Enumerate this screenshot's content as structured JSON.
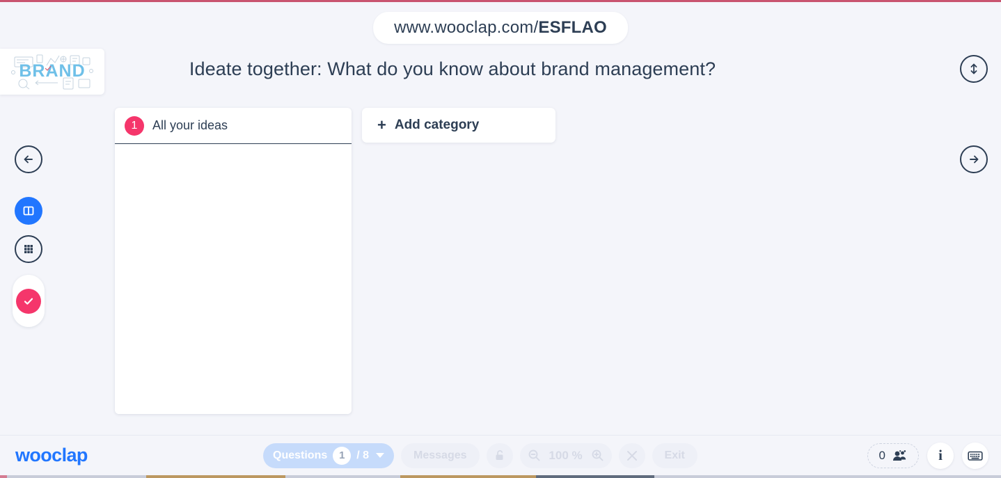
{
  "topbar": {
    "url_prefix": "www.wooclap.com/",
    "url_code": "ESFLAO"
  },
  "header": {
    "logo_alt": "BRAND",
    "logo_word": "BRAND",
    "question_title": "Ideate together: What do you know about brand management?"
  },
  "sidebar": {
    "items": [
      {
        "name": "previous-slide",
        "icon": "arrow-left-icon"
      },
      {
        "name": "columns-view",
        "icon": "columns-icon"
      },
      {
        "name": "grid-view",
        "icon": "grid-icon"
      },
      {
        "name": "validate-toggle",
        "icon": "check-icon"
      }
    ]
  },
  "rightbar": {
    "expand_icon": "arrows-up-down-icon",
    "next_icon": "arrow-right-icon"
  },
  "board": {
    "categories": [
      {
        "badge": "1",
        "label": "All your ideas",
        "ideas": []
      }
    ],
    "add_category": {
      "plus": "+",
      "label": "Add category"
    }
  },
  "bottombar": {
    "brand": "wooclap",
    "questions": {
      "label": "Questions",
      "current": "1",
      "total": "/ 8"
    },
    "messages_label": "Messages",
    "lock_icon": "unlock-icon",
    "zoom": {
      "out_icon": "zoom-out-icon",
      "value": "100 %",
      "in_icon": "zoom-in-icon"
    },
    "fullscreen_icon": "fullscreen-icon",
    "exit_label": "Exit",
    "participants": {
      "count": "0",
      "icon": "users-icon"
    },
    "info_glyph": "i",
    "keyboard_icon": "keyboard-icon"
  },
  "colors": {
    "accent_pink": "#f5366b",
    "accent_blue": "#2176ff",
    "text_dark": "#2d3e54",
    "background": "#f4f5fa",
    "pill_blue": "#c6dbfb"
  }
}
